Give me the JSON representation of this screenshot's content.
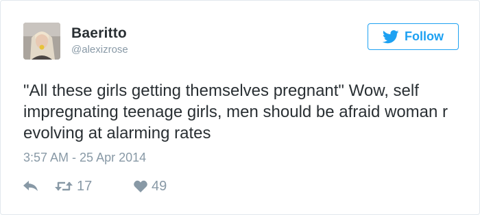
{
  "user": {
    "display_name": "Ваeritto",
    "handle": "@alexizrose"
  },
  "follow": {
    "label": "Follow"
  },
  "tweet": {
    "text": "\"All these girls getting themselves pregnant\" Wow, self impregnating teenage girls, men should be afraid woman r evolving at alarming rates",
    "timestamp": "3:57 AM - 25 Apr 2014"
  },
  "stats": {
    "retweets": "17",
    "likes": "49"
  },
  "icons": {
    "follow": "twitter-bird-icon",
    "reply": "reply-icon",
    "retweet": "retweet-icon",
    "like": "heart-icon"
  },
  "colors": {
    "accent": "#1da1f2",
    "muted": "#8899a6",
    "text": "#292f33",
    "border": "#e1e8ed"
  }
}
